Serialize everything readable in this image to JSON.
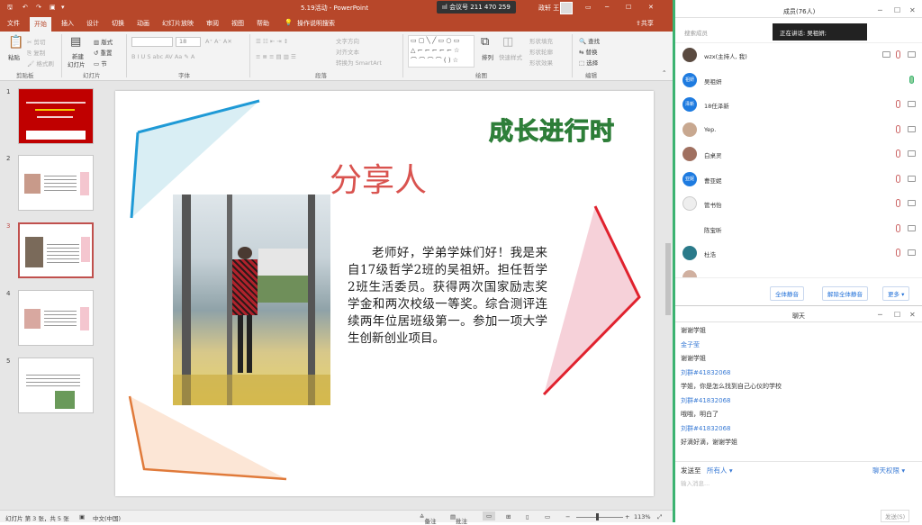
{
  "ppt": {
    "title": "5.19活动 - PowerPoint",
    "meeting_badge": "会议号 211 470 259",
    "user_name": "政轩 王",
    "tabs": [
      "文件",
      "开始",
      "插入",
      "设计",
      "切换",
      "动画",
      "幻灯片放映",
      "审阅",
      "视图",
      "帮助",
      "操作说明搜索"
    ],
    "share": "共享",
    "ribbon": {
      "clipboard": {
        "paste": "粘贴",
        "cut": "剪切",
        "copy": "复制",
        "painter": "格式刷",
        "group": "剪贴板"
      },
      "slides": {
        "new": "新建",
        "new2": "幻灯片",
        "layout": "版式",
        "reset": "重置",
        "section": "节",
        "group": "幻灯片"
      },
      "font": {
        "group": "字体",
        "size": "18"
      },
      "paragraph": {
        "dir": "文字方向",
        "align": "对齐文本",
        "smartart": "转换为 SmartArt",
        "group": "段落"
      },
      "drawing": {
        "arrange": "排列",
        "quick": "快速样式",
        "fill": "形状填充",
        "outline": "形状轮廓",
        "effect": "形状效果",
        "group": "绘图"
      },
      "editing": {
        "find": "查找",
        "replace": "替换",
        "select": "选择",
        "group": "编辑"
      }
    },
    "thumb_numbers": [
      "1",
      "2",
      "3",
      "4",
      "5"
    ],
    "slide": {
      "banner": "成长进行时",
      "title": "分享人",
      "body": "老师好，学弟学妹们好！我是来自17级哲学2班的吴祖妍。担任哲学2班生活委员。获得两次国家励志奖学金和两次校级一等奖。综合测评连续两年位居班级第一。参加一项大学生创新创业项目。"
    },
    "status": {
      "slide": "幻灯片 第 3 张，共 5 张",
      "lang": "中文(中国)",
      "notes": "备注",
      "comments": "批注",
      "zoom": "113%"
    }
  },
  "colors": {
    "ppt_red": "#b7472a",
    "banner_green": "#3aa64a",
    "title_red": "#d9534f",
    "panel_green": "#3cb371"
  },
  "meeting": {
    "members_title": "成员(76人)",
    "speaking": "正在讲话: 吴祖妍;",
    "search_placeholder": "搜索成员",
    "members": [
      {
        "name": "wzx(主持人, 我)",
        "avatar": ""
      },
      {
        "name": "吴祖妍",
        "avatar": "祖妍"
      },
      {
        "name": "18任泽新",
        "avatar": "泽新"
      },
      {
        "name": "Yep.",
        "avatar": ""
      },
      {
        "name": "白桌灵",
        "avatar": ""
      },
      {
        "name": "曹亚妮",
        "avatar": "亚妮"
      },
      {
        "name": "管书怡",
        "avatar": ""
      },
      {
        "name": "陈宝昕",
        "avatar": ""
      },
      {
        "name": "杜浩",
        "avatar": ""
      }
    ],
    "buttons": {
      "mute_all": "全体静音",
      "unmute_all": "解除全体静音",
      "more": "更多"
    },
    "chat_title": "聊天",
    "chat": [
      {
        "type": "msg",
        "text": "谢谢学姐"
      },
      {
        "type": "name",
        "text": "金子莹"
      },
      {
        "type": "msg",
        "text": "谢谢学姐"
      },
      {
        "type": "name",
        "text": "刘群#41832068"
      },
      {
        "type": "msg",
        "text": "学姐，你是怎么找到自己心仪的学校"
      },
      {
        "type": "name",
        "text": "刘群#41832068"
      },
      {
        "type": "msg",
        "text": "哦哦，明白了"
      },
      {
        "type": "name",
        "text": "刘群#41832068"
      },
      {
        "type": "msg",
        "text": "好滴好滴，谢谢学姐"
      }
    ],
    "send_to": "发送至",
    "recipient": "所有人",
    "chat_perm": "聊天权限",
    "input_placeholder": "输入消息...",
    "send": "发送(S)"
  }
}
